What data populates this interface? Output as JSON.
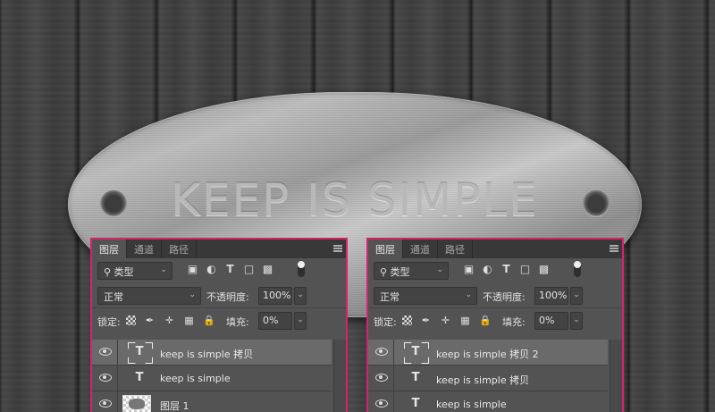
{
  "background": {
    "plate_text": "KEEP IS SIMPLE"
  },
  "panels": [
    {
      "tabs": [
        "图层",
        "通道",
        "路径"
      ],
      "filter": {
        "label": "类型"
      },
      "blend": {
        "mode": "正常",
        "opacity_label": "不透明度:",
        "opacity_value": "100%"
      },
      "lock": {
        "label": "锁定:",
        "fill_label": "填充:",
        "fill_value": "0%"
      },
      "layers": [
        {
          "name": "keep is simple  拷贝",
          "type": "text",
          "selected": true
        },
        {
          "name": "keep is simple",
          "type": "text",
          "selected": false
        },
        {
          "name": "图层 1",
          "type": "image",
          "selected": false
        }
      ]
    },
    {
      "tabs": [
        "图层",
        "通道",
        "路径"
      ],
      "filter": {
        "label": "类型"
      },
      "blend": {
        "mode": "正常",
        "opacity_label": "不透明度:",
        "opacity_value": "100%"
      },
      "lock": {
        "label": "锁定:",
        "fill_label": "填充:",
        "fill_value": "0%"
      },
      "layers": [
        {
          "name": "keep is simple  拷贝 2",
          "type": "text",
          "selected": true
        },
        {
          "name": "keep is simple  拷贝",
          "type": "text",
          "selected": false
        },
        {
          "name": "keep is simple",
          "type": "text",
          "selected": false
        }
      ]
    }
  ],
  "icons": {
    "filter": [
      "search-icon",
      "image-filter-icon",
      "adjustment-filter-icon",
      "type-filter-icon",
      "shape-filter-icon",
      "smart-object-filter-icon"
    ],
    "lock": [
      "lock-transparent-icon",
      "lock-image-icon",
      "lock-position-icon",
      "lock-artboard-icon",
      "lock-all-icon"
    ]
  },
  "colors": {
    "highlight_border": "#d6246b",
    "panel_bg": "#535353"
  }
}
